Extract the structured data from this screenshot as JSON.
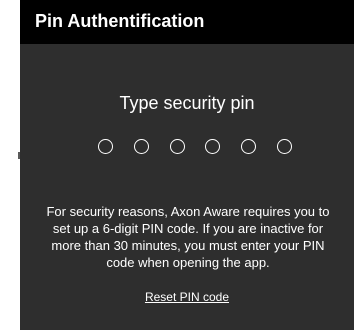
{
  "dialog": {
    "title": "Pin Authentification",
    "prompt": "Type security pin",
    "pin_length": 6,
    "pin_entered": 0,
    "info_line_1": "For security reasons, Axon Aware requires you to",
    "info_line_2": "set up a 6-digit PIN code. If you are inactive for",
    "info_line_3": "more than 30 minutes, you must enter your PIN",
    "info_line_4": "code when opening the app.",
    "reset_label": "Reset PIN code"
  },
  "colors": {
    "header_background": "#000000",
    "dialog_background": "#2e2e2e",
    "text": "#ffffff",
    "page_background": "#ffffff"
  }
}
